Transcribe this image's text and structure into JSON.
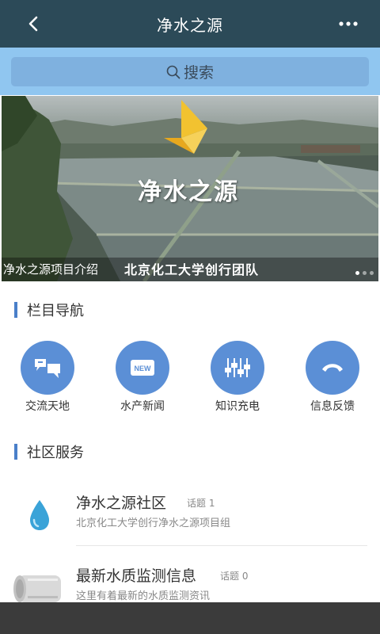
{
  "header": {
    "title": "净水之源",
    "back_icon": "chevron-left-icon",
    "more_icon": "more-dots-icon"
  },
  "search": {
    "label": "搜索",
    "icon": "search-icon"
  },
  "banner": {
    "title": "净水之源",
    "caption_left": "净水之源项目介绍",
    "caption_right": "北京化工大学创行团队",
    "slide_count": 3,
    "active_slide": 1
  },
  "nav_section": {
    "title": "栏目导航",
    "items": [
      {
        "label": "交流天地",
        "icon": "chat-bubbles-icon"
      },
      {
        "label": "水产新闻",
        "icon": "news-icon"
      },
      {
        "label": "知识充电",
        "icon": "sliders-icon"
      },
      {
        "label": "信息反馈",
        "icon": "phone-icon"
      }
    ]
  },
  "service_section": {
    "title": "社区服务",
    "items": [
      {
        "name": "净水之源社区",
        "topic": "话题 1",
        "desc": "北京化工大学创行净水之源项目组",
        "icon": "water-drop-icon"
      },
      {
        "name": "最新水质监测信息",
        "topic": "话题 0",
        "desc": "这里有着最新的水质监测资讯",
        "icon": "water-tank-icon"
      }
    ]
  },
  "colors": {
    "header_bg": "#2c4a58",
    "search_bg": "#90c6f0",
    "accent": "#5b8fd6",
    "section_bar": "#4a7fc9"
  }
}
